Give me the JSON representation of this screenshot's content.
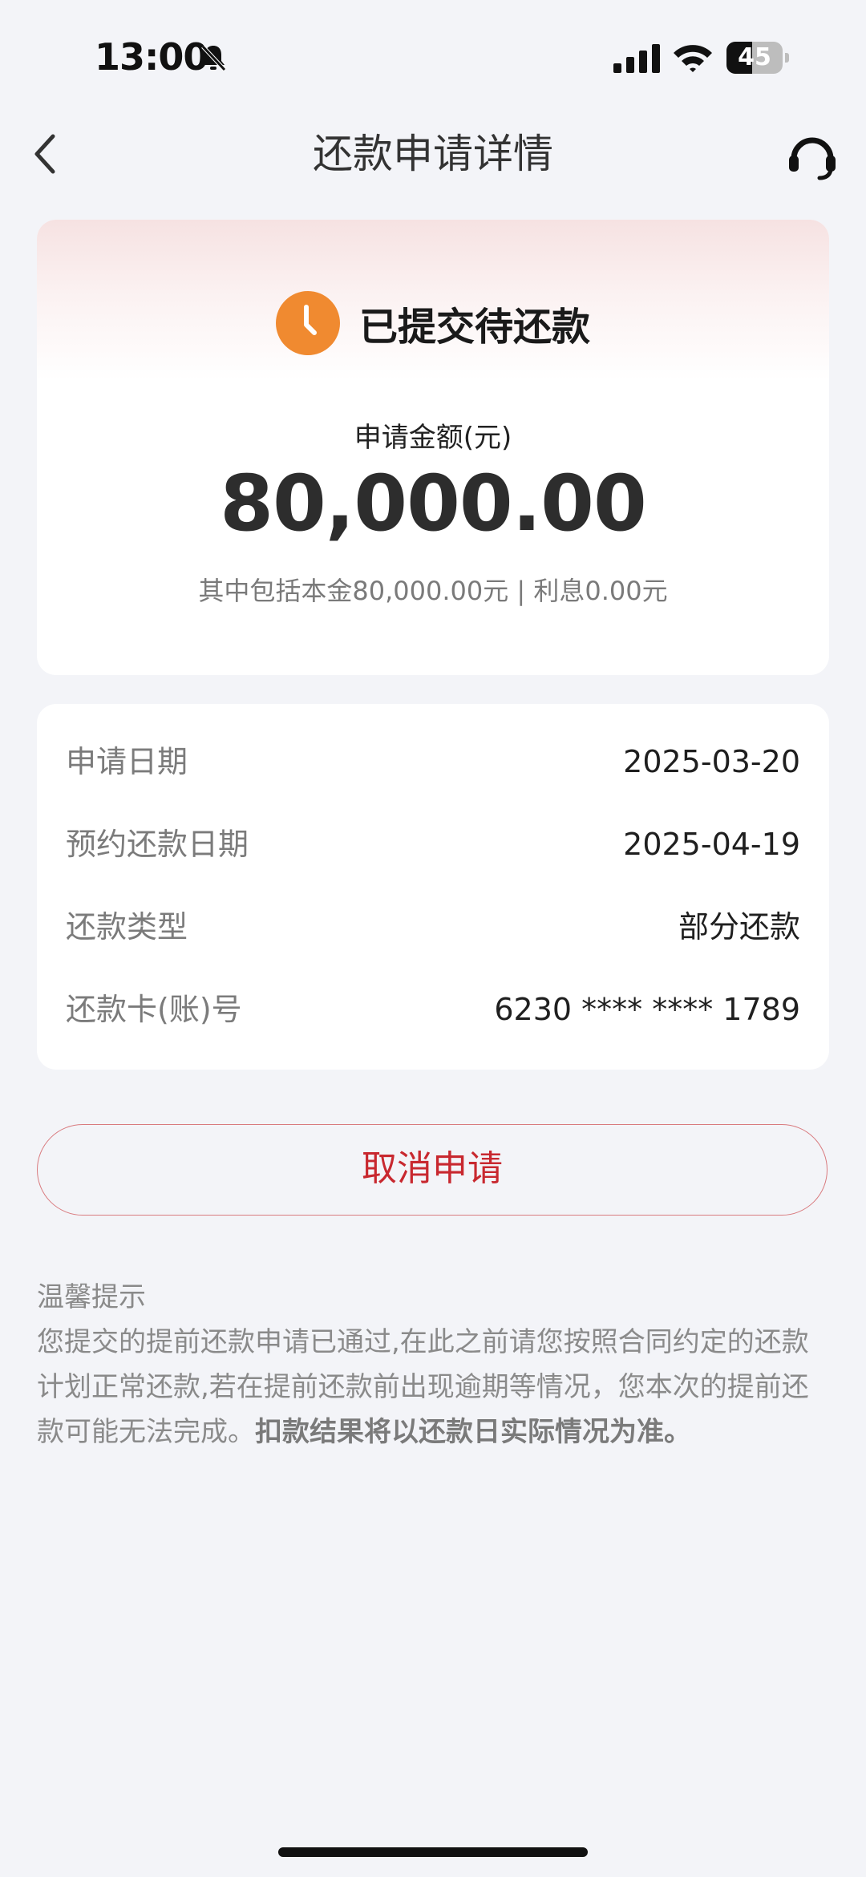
{
  "status_bar": {
    "time": "13:00",
    "battery": "45",
    "battery_percent": 45
  },
  "nav": {
    "title": "还款申请详情"
  },
  "summary": {
    "status": "已提交待还款",
    "amount_label": "申请金额(元)",
    "amount": "80,000.00",
    "breakdown": "其中包括本金80,000.00元 | 利息0.00元"
  },
  "details": [
    {
      "label": "申请日期",
      "value": "2025-03-20"
    },
    {
      "label": "预约还款日期",
      "value": "2025-04-19"
    },
    {
      "label": "还款类型",
      "value": "部分还款"
    },
    {
      "label": "还款卡(账)号",
      "value": "6230 **** **** 1789"
    }
  ],
  "actions": {
    "cancel_label": "取消申请"
  },
  "tips": {
    "title": "温馨提示",
    "body": "您提交的提前还款申请已通过,在此之前请您按照合同约定的还款计划正常还款,若在提前还款前出现逾期等情况，您本次的提前还款可能无法完成。",
    "bold": "扣款结果将以还款日实际情况为准。"
  },
  "colors": {
    "accent": "#c8282f",
    "status_icon": "#f08a30",
    "background": "#f3f4f8"
  },
  "icons": {
    "back": "chevron-left-icon",
    "service": "headset-icon",
    "status": "clock-icon"
  }
}
